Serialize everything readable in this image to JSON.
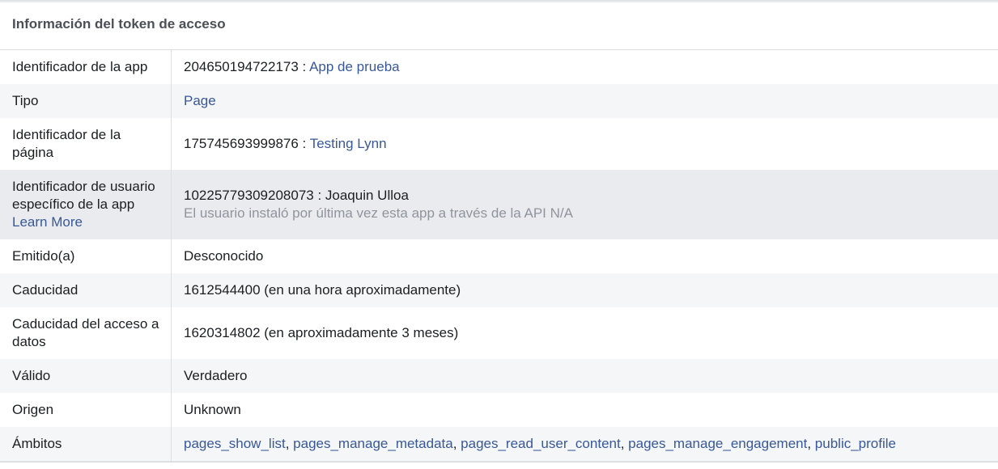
{
  "title": "Información del token de acceso",
  "rows": {
    "app_id": {
      "label": "Identificador de la app",
      "id": "204650194722173",
      "sep": " : ",
      "name": "App de prueba"
    },
    "type": {
      "label": "Tipo",
      "value": "Page"
    },
    "page_id": {
      "label": "Identificador de la página",
      "id": "175745693999876",
      "sep": " : ",
      "name": "Testing Lynn"
    },
    "app_user_id": {
      "label": "Identificador de usuario específico de la app",
      "learn_more": "Learn More",
      "value": "10225779309208073 : Joaquin Ulloa",
      "note": "El usuario instaló por última vez esta app a través de la API N/A"
    },
    "issued": {
      "label": "Emitido(a)",
      "value": "Desconocido"
    },
    "expires": {
      "label": "Caducidad",
      "value": "1612544400 (en una hora aproximadamente)"
    },
    "data_access_expires": {
      "label": "Caducidad del acceso a datos",
      "value": "1620314802 (en aproximadamente 3 meses)"
    },
    "valid": {
      "label": "Válido",
      "value": "Verdadero"
    },
    "origin": {
      "label": "Origen",
      "value": "Unknown"
    },
    "scopes": {
      "label": "Ámbitos",
      "items": [
        "pages_show_list",
        "pages_manage_metadata",
        "pages_read_user_content",
        "pages_manage_engagement",
        "public_profile"
      ],
      "separator": ", "
    }
  }
}
